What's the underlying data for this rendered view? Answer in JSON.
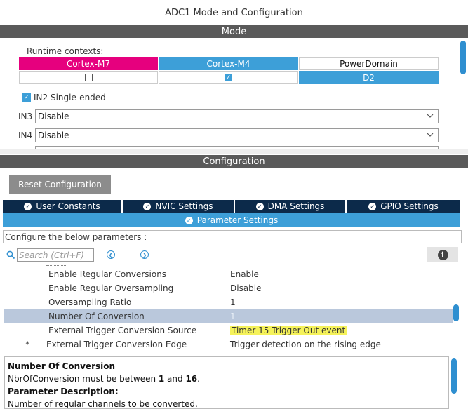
{
  "window": {
    "title": "ADC1 Mode and Configuration"
  },
  "mode": {
    "header": "Mode",
    "runtime_label": "Runtime contexts:",
    "contexts": [
      {
        "name": "Cortex-M7",
        "color": "#e6007e",
        "checked": false
      },
      {
        "name": "Cortex-M4",
        "color": "#3d9fd8",
        "checked": true
      },
      {
        "name": "PowerDomain",
        "value": "D2"
      }
    ],
    "in2_label": "IN2 Single-ended",
    "in3": {
      "label": "IN3",
      "value": "Disable"
    },
    "in4": {
      "label": "IN4",
      "value": "Disable"
    }
  },
  "configuration": {
    "header": "Configuration",
    "reset_label": "Reset Configuration",
    "tabs": [
      "User Constants",
      "NVIC Settings",
      "DMA Settings",
      "GPIO Settings"
    ],
    "active_tab": "Parameter Settings",
    "configure_text": "Configure the below parameters :",
    "search_placeholder": "Search (Ctrl+F)",
    "params": [
      {
        "name": "Enable Regular Conversions",
        "value": "Enable",
        "marker": ""
      },
      {
        "name": "Enable Regular Oversampling",
        "value": "Disable",
        "marker": ""
      },
      {
        "name": "Oversampling Ratio",
        "value": "1",
        "marker": ""
      },
      {
        "name": "Number Of Conversion",
        "value": "1",
        "marker": "",
        "selected": true
      },
      {
        "name": "External Trigger Conversion Source",
        "value": "Timer 15 Trigger Out event",
        "marker": "",
        "highlight": true
      },
      {
        "name": "External Trigger Conversion Edge",
        "value": "Trigger detection on the rising edge",
        "marker": "*"
      }
    ],
    "description": {
      "title": "Number Of Conversion",
      "line_prefix": "NbrOfConversion must be between ",
      "min": "1",
      "and": " and ",
      "max": "16",
      "suffix": ".",
      "param_desc_title": "Parameter Description:",
      "param_desc_text": "Number of regular channels to be converted."
    }
  },
  "colors": {
    "accent": "#3d9fd8",
    "tab_dark": "#0c2a4a",
    "section_bar": "#5a5a5a",
    "highlight": "#f5f25a"
  }
}
